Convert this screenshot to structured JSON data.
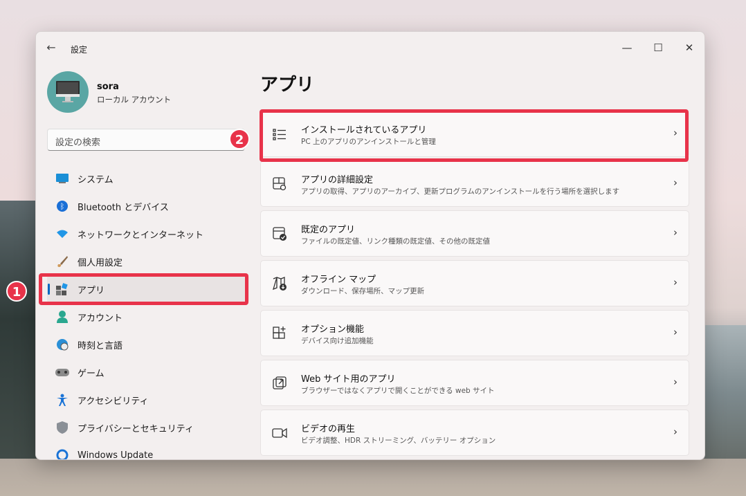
{
  "window": {
    "title": "設定"
  },
  "user": {
    "name": "sora",
    "account_type": "ローカル アカウント"
  },
  "search": {
    "placeholder": "設定の検索"
  },
  "nav": {
    "items": [
      {
        "label": "システム",
        "icon": "system-icon"
      },
      {
        "label": "Bluetooth とデバイス",
        "icon": "bluetooth-icon"
      },
      {
        "label": "ネットワークとインターネット",
        "icon": "network-icon"
      },
      {
        "label": "個人用設定",
        "icon": "brush-icon"
      },
      {
        "label": "アプリ",
        "icon": "apps-icon",
        "selected": true
      },
      {
        "label": "アカウント",
        "icon": "account-icon"
      },
      {
        "label": "時刻と言語",
        "icon": "time-language-icon"
      },
      {
        "label": "ゲーム",
        "icon": "gamepad-icon"
      },
      {
        "label": "アクセシビリティ",
        "icon": "accessibility-icon"
      },
      {
        "label": "プライバシーとセキュリティ",
        "icon": "shield-icon"
      },
      {
        "label": "Windows Update",
        "icon": "update-icon"
      }
    ]
  },
  "main": {
    "title": "アプリ",
    "cards": [
      {
        "title": "インストールされているアプリ",
        "desc": "PC 上のアプリのアンインストールと管理",
        "icon": "list-icon"
      },
      {
        "title": "アプリの詳細設定",
        "desc": "アプリの取得、アプリのアーカイブ、更新プログラムのアンインストールを行う場所を選択します",
        "icon": "advanced-settings-icon"
      },
      {
        "title": "既定のアプリ",
        "desc": "ファイルの既定値、リンク種類の既定値、その他の既定値",
        "icon": "default-apps-icon"
      },
      {
        "title": "オフライン マップ",
        "desc": "ダウンロード、保存場所、マップ更新",
        "icon": "map-icon"
      },
      {
        "title": "オプション機能",
        "desc": "デバイス向け追加機能",
        "icon": "optional-features-icon"
      },
      {
        "title": "Web サイト用のアプリ",
        "desc": "ブラウザーではなくアプリで開くことができる web サイト",
        "icon": "open-in-app-icon"
      },
      {
        "title": "ビデオの再生",
        "desc": "ビデオ調整、HDR ストリーミング、バッテリー オプション",
        "icon": "video-icon"
      }
    ]
  },
  "annotations": {
    "badge_1": "1",
    "badge_2": "2"
  },
  "colors": {
    "highlight": "#e8334a",
    "accent": "#0067c0"
  }
}
